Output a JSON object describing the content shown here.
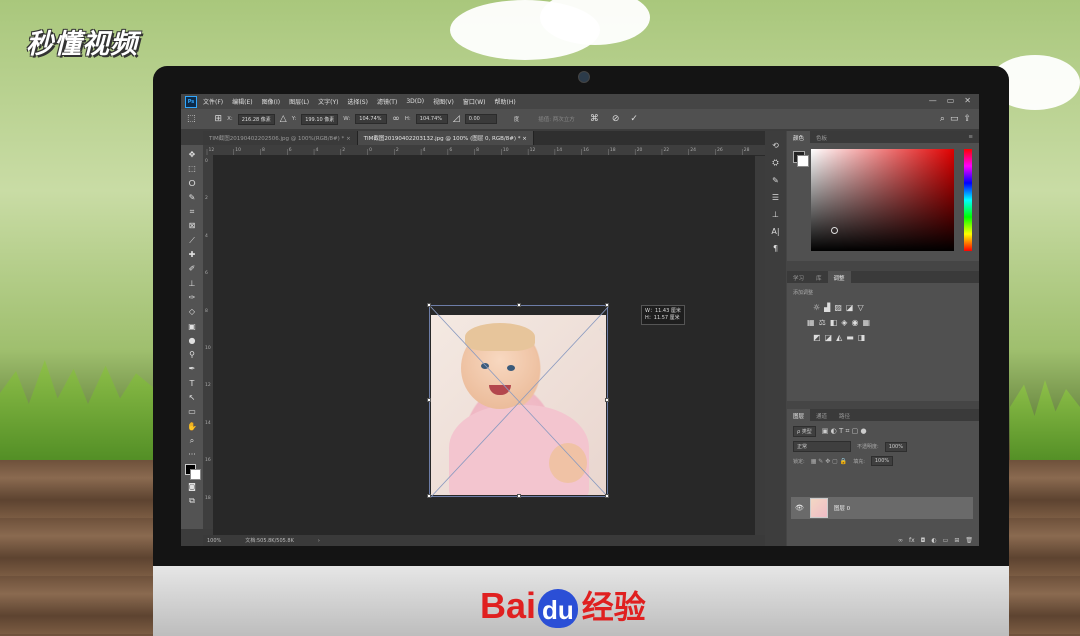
{
  "overlay": {
    "logo_text": "秒懂视频",
    "brand_left": "Bai",
    "brand_du": "du",
    "brand_right": "经验"
  },
  "ps": {
    "app_logo": "Ps",
    "menu": [
      "文件(F)",
      "编辑(E)",
      "图像(I)",
      "图层(L)",
      "文字(Y)",
      "选择(S)",
      "滤镜(T)",
      "3D(D)",
      "视图(V)",
      "窗口(W)",
      "帮助(H)"
    ],
    "window_buttons": [
      "—",
      "▭",
      "✕"
    ],
    "options": {
      "x_label": "X:",
      "x_value": "216.28 像素",
      "y_label": "Y:",
      "y_value": "199.10 像素",
      "w_label": "W:",
      "w_value": "104.74%",
      "h_label": "H:",
      "h_value": "104.74%",
      "angle_value": "0.00",
      "angle_unit": "度",
      "interp_label": "插值: 两次立方",
      "commit_icon": "check-icon",
      "cancel_icon": "cancel-icon"
    },
    "tabs": [
      {
        "label": "TIM截图20190402202506.jpg @ 100%(RGB/8#) *",
        "close": "×",
        "active": false
      },
      {
        "label": "TIM截图20190402203132.jpg @ 100% (图层 0, RGB/8#) *",
        "close": "×",
        "active": true
      }
    ],
    "ruler_h_labels": [
      "12",
      "10",
      "8",
      "6",
      "4",
      "2",
      "0",
      "2",
      "4",
      "6",
      "8",
      "10",
      "12",
      "14",
      "16",
      "18",
      "20",
      "22",
      "24",
      "26",
      "28"
    ],
    "ruler_v_labels": [
      "0",
      "2",
      "4",
      "6",
      "8",
      "10",
      "12",
      "14",
      "16",
      "18"
    ],
    "tooltip": {
      "w": "W：11.43 厘米",
      "h": "H：11.57 厘米"
    },
    "status": {
      "zoom": "100%",
      "doc": "文档:505.8K/505.8K",
      "arrow": "›"
    },
    "color_panel": {
      "tabs": [
        "颜色",
        "色板"
      ],
      "menu": "≡"
    },
    "adjust_panel": {
      "tabs": [
        "学习",
        "库",
        "调整"
      ],
      "subtitle": "添加调整"
    },
    "layers_panel": {
      "tabs": [
        "图层",
        "通道",
        "路径"
      ],
      "kind_label": "ρ 类型",
      "blend_mode": "正常",
      "opacity_label": "不透明度:",
      "opacity_value": "100%",
      "lock_label": "锁定:",
      "fill_label": "填充:",
      "fill_value": "100%",
      "layer_name": "图层 0",
      "bottom_icons": [
        "∞",
        "fx",
        "◘",
        "◐",
        "▭",
        "⊞",
        "🗑"
      ]
    }
  }
}
